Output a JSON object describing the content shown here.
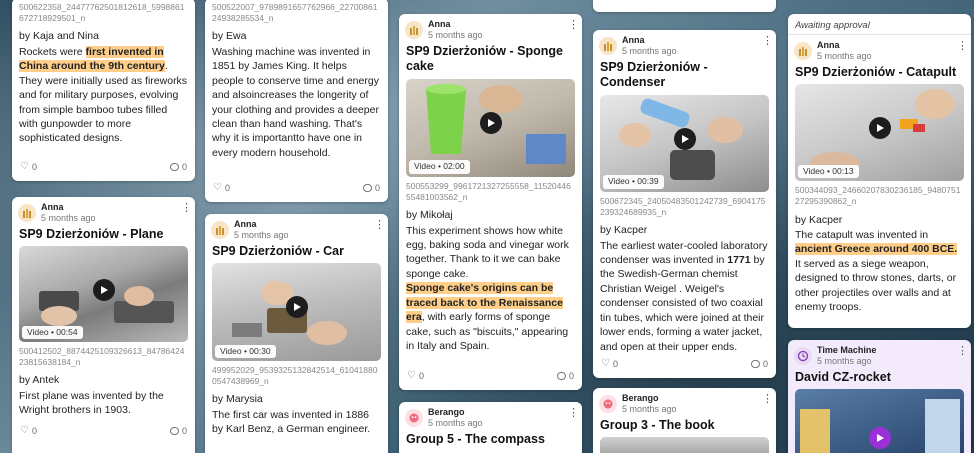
{
  "cards": {
    "rockets": {
      "filename": "500622358_24477762501812618_5998861672718929501_n",
      "by": "by Kaja and Nina",
      "text_a": "Rockets were ",
      "text_hl": "first invented in China around the 9th century",
      "text_b": ". They were initially used as fireworks and for military purposes, evolving from simple bamboo tubes filled with gunpowder to more sophisticated designs.",
      "likes": "0",
      "comments": "0"
    },
    "plane": {
      "author": "Anna",
      "time": "5 months ago",
      "title": "SP9 Dzierżoniów - Plane",
      "video": "Video • 00:54",
      "filename": "500412502_8874425109326613_8478642423815638184_n",
      "by": "by Antek",
      "text": "First plane was invented by the Wright brothers in 1903.",
      "likes": "0",
      "comments": "0"
    },
    "washing": {
      "filename": "500522007_9789891657762966_2270086124938285534_n",
      "by": "by Ewa",
      "text": "Washing machine was invented in 1851 by James King.  It helps people to conserve time and energy and alsoincreases the longerity of your clothing and provides a deeper clean than hand washing. That's why it is importantto have one in every modern household.",
      "likes": "0",
      "comments": "0"
    },
    "car": {
      "author": "Anna",
      "time": "5 months ago",
      "title": "SP9 Dzierżoniów - Car",
      "video": "Video • 00:30",
      "filename": "499952029_9539325132842514_610418800547438969_n",
      "by": "by Marysia",
      "text": "The first car was invented in 1886 by Karl Benz, a German engineer."
    },
    "sponge": {
      "author": "Anna",
      "time": "5 months ago",
      "title": "SP9 Dzierżoniów - Sponge cake",
      "video": "Video • 02:00",
      "filename": "500553299_9961721327255558_1152044655481003562_n",
      "by": "by Mikołaj",
      "text_a": "This experiment shows how white egg, baking soda and vinegar work together. Thank to it we can bake sponge cake.",
      "text_hl": "Sponge cake's origins can be traced back to the Renaissance era",
      "text_b": ", with early forms of sponge cake, such as \"biscuits,\" appearing in Italy and Spain.",
      "likes": "0",
      "comments": "0"
    },
    "compass": {
      "author": "Berango",
      "time": "5 months ago",
      "title": "Group 5 - The compass"
    },
    "condenser": {
      "author": "Anna",
      "time": "5 months ago",
      "title": "SP9 Dzierżoniów - Condenser",
      "video": "Video • 00:39",
      "filename": "500672345_24050483501242739_6904175239324689935_n",
      "by": "by Kacper",
      "text_a": "The earliest water-cooled laboratory condenser was invented in ",
      "text_b1": "1771",
      "text_c": " by the Swedish-German chemist Christian Weigel . Weigel's condenser consisted of two coaxial tin tubes, which were joined at their lower ends, forming a water jacket, and open at their upper ends.",
      "likes": "0",
      "comments": "0"
    },
    "book": {
      "author": "Berango",
      "time": "5 months ago",
      "title": "Group 3 -  The book"
    },
    "catapult": {
      "approval": "Awaiting approval",
      "author": "Anna",
      "time": "5 months ago",
      "title": "SP9 Dzierżoniów - Catapult",
      "video": "Video • 00:13",
      "filename": "500344093_24660207830236185_948075127295390862_n",
      "by": "by Kacper",
      "text_a": "The catapult was invented in ",
      "text_hl": "ancient Greece around 400 BCE.",
      "text_b": "It served as a siege weapon, designed to throw stones, darts, or other projectiles over walls and at enemy troops."
    },
    "czrocket": {
      "author": "Time Machine",
      "time": "5 months ago",
      "title": "David  CZ-rocket"
    }
  },
  "colors": {
    "highlight": "#ffcf8a",
    "card": "#ffffff",
    "purple_card": "#f3eafb",
    "purple_play": "#9b30d9"
  }
}
